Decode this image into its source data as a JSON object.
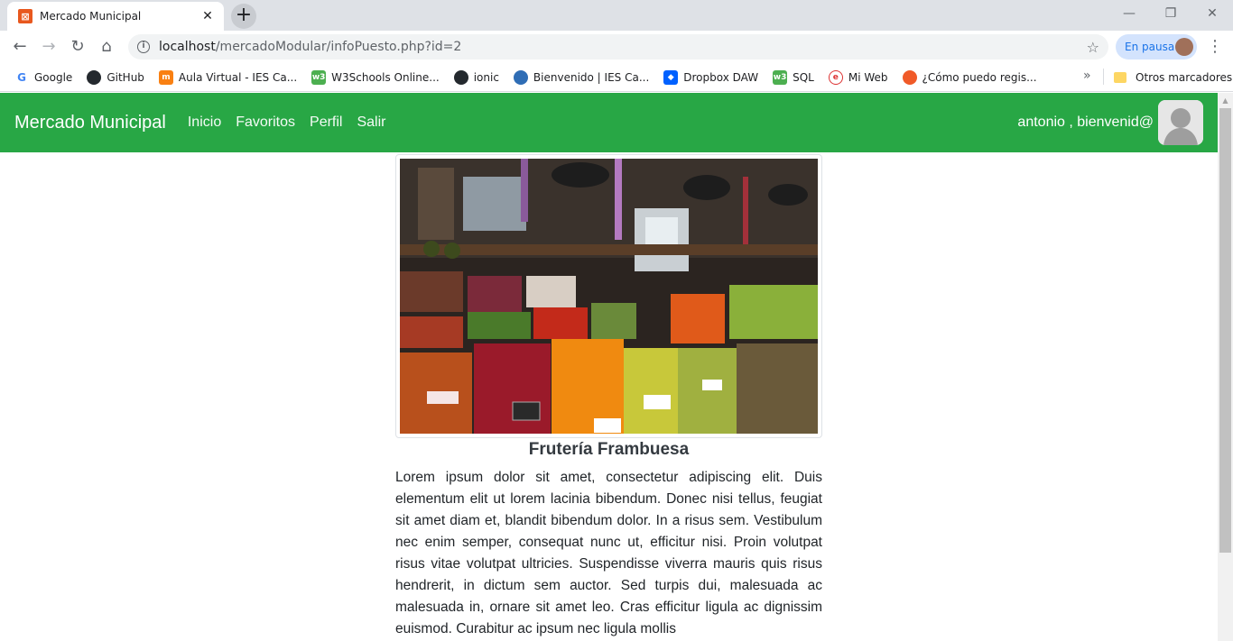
{
  "browser": {
    "tab_title": "Mercado Municipal",
    "address_host": "localhost",
    "address_path": "/mercadoModular/infoPuesto.php?id=2",
    "pause_label": "En pausa",
    "bookmarks": [
      "Google",
      "GitHub",
      "Aula Virtual - IES Ca...",
      "W3Schools Online...",
      "ionic",
      "Bienvenido | IES Ca...",
      "Dropbox DAW",
      "SQL",
      "Mi Web",
      "¿Cómo puedo regis..."
    ],
    "other_bookmarks": "Otros marcadores"
  },
  "navbar": {
    "brand": "Mercado Municipal",
    "links": [
      "Inicio",
      "Favoritos",
      "Perfil",
      "Salir"
    ],
    "greeting": "antonio , bienvenid@"
  },
  "puesto": {
    "name": "Frutería Frambuesa",
    "description": "Lorem ipsum dolor sit amet, consectetur adipiscing elit. Duis elementum elit ut lorem lacinia bibendum. Donec nisi tellus, feugiat sit amet diam et, blandit bibendum dolor. In a risus sem. Vestibulum nec enim semper, consequat nunc ut, efficitur nisi. Proin volutpat risus vitae volutpat ultricies. Suspendisse viverra mauris quis risus hendrerit, in dictum sem auctor. Sed turpis dui, malesuada ac malesuada in, ornare sit amet leo. Cras efficitur ligula ac dignissim euismod. Curabitur ac ipsum nec ligula mollis"
  },
  "colors": {
    "navbar": "#28a745",
    "tab_favicon": "#e8581e"
  },
  "icons": {
    "favicon": "xampp-icon",
    "back": "back-arrow-icon",
    "forward": "forward-arrow-icon",
    "reload": "reload-icon",
    "home": "home-icon",
    "info": "info-icon",
    "star": "star-icon"
  }
}
